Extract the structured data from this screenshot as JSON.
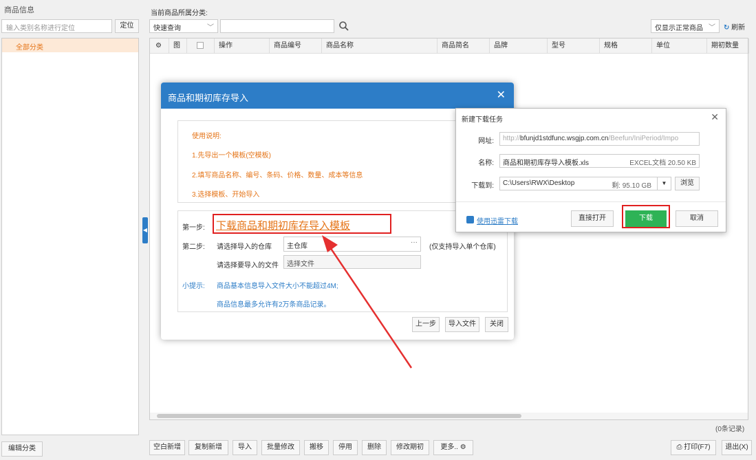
{
  "left": {
    "title": "商品信息",
    "search_placeholder": "输入类别名称进行定位",
    "locate_label": "定位",
    "tree_item": "全部分类",
    "edit_category_label": "编辑分类"
  },
  "toolbar": {
    "category_label": "当前商品所属分类:",
    "filter_select": "快速查询",
    "show_select": "仅显示正常商品",
    "refresh_label": "刷新"
  },
  "grid": {
    "columns": [
      "图",
      "操作",
      "商品编号",
      "商品名称",
      "商品简名",
      "品牌",
      "型号",
      "规格",
      "单位",
      "期初数量"
    ],
    "count_label": "(0条记录)"
  },
  "bottom_buttons": [
    "空白新增",
    "复制新增",
    "导入",
    "批量修改",
    "删除",
    "停用",
    "删除",
    "修改期初",
    "更多.."
  ],
  "print_label": "打印(F7)",
  "exit_label": "退出(X)",
  "import_dialog": {
    "title": "商品和期初库存导入",
    "instructions": [
      "使用说明:",
      "1.先导出一个模板(空模板)",
      "2.填写商品名称、编号、条码、价格、数量、成本等信息",
      "3.选择模板、开始导入"
    ],
    "step1_label": "第一步:",
    "step1_link": "下载商品和期初库存导入模板",
    "step2_label": "第二步:",
    "warehouse_label": "请选择导入的仓库",
    "warehouse_value": "主仓库",
    "warehouse_note": "(仅支持导入单个仓库)",
    "file_label": "请选择要导入的文件",
    "file_value": "选择文件",
    "tip_label": "小提示:",
    "tip1": "商品基本信息导入文件大小不能超过4M;",
    "tip2": "商品信息最多允许有2万条商品记录。",
    "prev_label": "上一步",
    "import_label": "导入文件",
    "close_label": "关闭"
  },
  "download_dialog": {
    "title": "新建下载任务",
    "url_label": "网址:",
    "url_prefix": "http://",
    "url_host": "bfunjd1stdfunc.wsgjp.com.cn",
    "url_rest": "/Beefun/IniPeriod/Impo",
    "name_label": "名称:",
    "name_value": "商品和期初库存导入模板.xls",
    "name_meta": "EXCEL文档 20.50 KB",
    "path_label": "下载到:",
    "path_value": "C:\\Users\\RWX\\Desktop",
    "path_free": "剩: 95.10 GB",
    "browse_label": "浏览",
    "xunlei_label": "使用迅雷下载",
    "open_label": "直接打开",
    "download_label": "下载",
    "cancel_label": "取消"
  }
}
